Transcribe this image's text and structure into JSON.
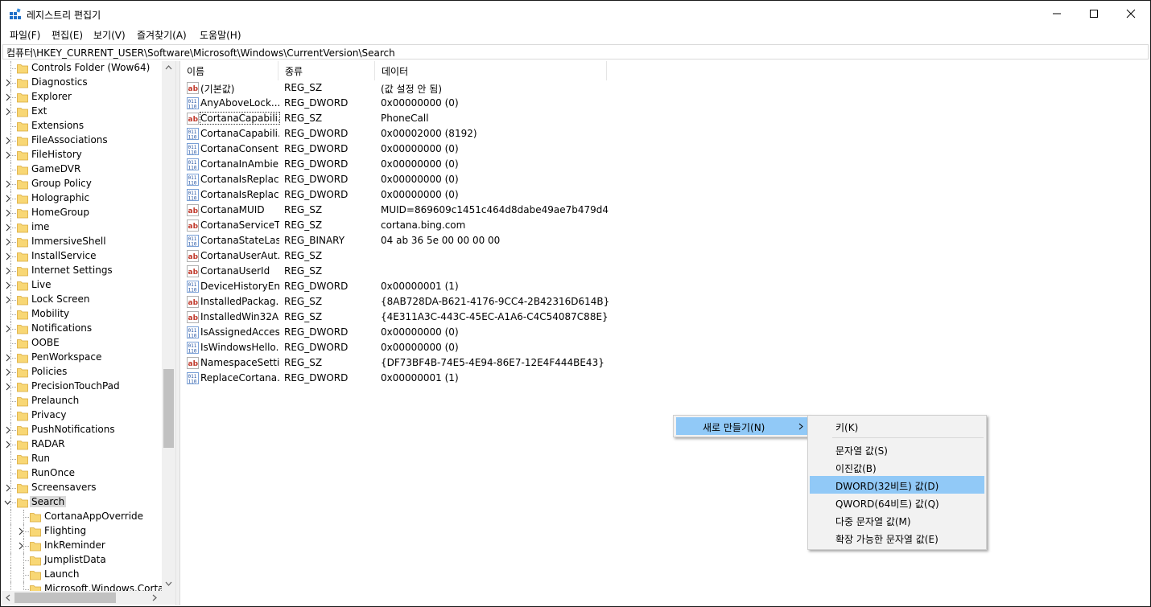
{
  "window": {
    "title": "레지스트리 편집기"
  },
  "menu": [
    "파일(F)",
    "편집(E)",
    "보기(V)",
    "즐겨찾기(A)",
    "도움말(H)"
  ],
  "address": "컴퓨터\\HKEY_CURRENT_USER\\Software\\Microsoft\\Windows\\CurrentVersion\\Search",
  "tree": {
    "items": [
      {
        "label": "Controls Folder (Wow64)",
        "expandable": false
      },
      {
        "label": "Diagnostics",
        "expandable": true
      },
      {
        "label": "Explorer",
        "expandable": true
      },
      {
        "label": "Ext",
        "expandable": true
      },
      {
        "label": "Extensions",
        "expandable": false
      },
      {
        "label": "FileAssociations",
        "expandable": true
      },
      {
        "label": "FileHistory",
        "expandable": true
      },
      {
        "label": "GameDVR",
        "expandable": false
      },
      {
        "label": "Group Policy",
        "expandable": true
      },
      {
        "label": "Holographic",
        "expandable": true
      },
      {
        "label": "HomeGroup",
        "expandable": true
      },
      {
        "label": "ime",
        "expandable": true
      },
      {
        "label": "ImmersiveShell",
        "expandable": true
      },
      {
        "label": "InstallService",
        "expandable": true
      },
      {
        "label": "Internet Settings",
        "expandable": true
      },
      {
        "label": "Live",
        "expandable": true
      },
      {
        "label": "Lock Screen",
        "expandable": true
      },
      {
        "label": "Mobility",
        "expandable": false
      },
      {
        "label": "Notifications",
        "expandable": true
      },
      {
        "label": "OOBE",
        "expandable": false
      },
      {
        "label": "PenWorkspace",
        "expandable": true
      },
      {
        "label": "Policies",
        "expandable": true
      },
      {
        "label": "PrecisionTouchPad",
        "expandable": true
      },
      {
        "label": "Prelaunch",
        "expandable": false
      },
      {
        "label": "Privacy",
        "expandable": false
      },
      {
        "label": "PushNotifications",
        "expandable": true
      },
      {
        "label": "RADAR",
        "expandable": true
      },
      {
        "label": "Run",
        "expandable": false
      },
      {
        "label": "RunOnce",
        "expandable": false
      },
      {
        "label": "Screensavers",
        "expandable": true
      },
      {
        "label": "Search",
        "expandable": true,
        "expanded": true,
        "selected": true
      },
      {
        "label": "CortanaAppOverride",
        "expandable": false,
        "child": true
      },
      {
        "label": "Flighting",
        "expandable": true,
        "child": true
      },
      {
        "label": "InkReminder",
        "expandable": true,
        "child": true
      },
      {
        "label": "JumplistData",
        "expandable": false,
        "child": true
      },
      {
        "label": "Launch",
        "expandable": false,
        "child": true
      },
      {
        "label": "Microsoft.Windows.Cortana",
        "expandable": false,
        "child": true
      }
    ]
  },
  "list": {
    "columns": [
      "이름",
      "종류",
      "데이터"
    ],
    "rows": [
      {
        "icon": "ab",
        "name": "(기본값)",
        "type": "REG_SZ",
        "data": "(값 설정 안 됨)"
      },
      {
        "icon": "bin",
        "name": "AnyAboveLock...",
        "type": "REG_DWORD",
        "data": "0x00000000 (0)"
      },
      {
        "icon": "ab",
        "name": "CortanaCapabili...",
        "type": "REG_SZ",
        "data": "PhoneCall",
        "focused": true
      },
      {
        "icon": "bin",
        "name": "CortanaCapabili...",
        "type": "REG_DWORD",
        "data": "0x00002000 (8192)"
      },
      {
        "icon": "bin",
        "name": "CortanaConsent",
        "type": "REG_DWORD",
        "data": "0x00000000 (0)"
      },
      {
        "icon": "bin",
        "name": "CortanaInAmbie...",
        "type": "REG_DWORD",
        "data": "0x00000000 (0)"
      },
      {
        "icon": "bin",
        "name": "CortanaIsReplac...",
        "type": "REG_DWORD",
        "data": "0x00000000 (0)"
      },
      {
        "icon": "bin",
        "name": "CortanaIsReplac...",
        "type": "REG_DWORD",
        "data": "0x00000000 (0)"
      },
      {
        "icon": "ab",
        "name": "CortanaMUID",
        "type": "REG_SZ",
        "data": "MUID=869609c1451c464d8dabe49ae7b479d4"
      },
      {
        "icon": "ab",
        "name": "CortanaServiceT...",
        "type": "REG_SZ",
        "data": "cortana.bing.com"
      },
      {
        "icon": "bin",
        "name": "CortanaStateLas...",
        "type": "REG_BINARY",
        "data": "04 ab 36 5e 00 00 00 00"
      },
      {
        "icon": "ab",
        "name": "CortanaUserAut...",
        "type": "REG_SZ",
        "data": ""
      },
      {
        "icon": "ab",
        "name": "CortanaUserId",
        "type": "REG_SZ",
        "data": ""
      },
      {
        "icon": "bin",
        "name": "DeviceHistoryEn...",
        "type": "REG_DWORD",
        "data": "0x00000001 (1)"
      },
      {
        "icon": "ab",
        "name": "InstalledPackag...",
        "type": "REG_SZ",
        "data": "{8AB728DA-B621-4176-9CC4-2B42316D614B}"
      },
      {
        "icon": "ab",
        "name": "InstalledWin32A...",
        "type": "REG_SZ",
        "data": "{4E311A3C-443C-45EC-A1A6-C4C54087C88E}"
      },
      {
        "icon": "bin",
        "name": "IsAssignedAccess",
        "type": "REG_DWORD",
        "data": "0x00000000 (0)"
      },
      {
        "icon": "bin",
        "name": "IsWindowsHello...",
        "type": "REG_DWORD",
        "data": "0x00000000 (0)"
      },
      {
        "icon": "ab",
        "name": "NamespaceSetti...",
        "type": "REG_SZ",
        "data": "{DF73BF4B-74E5-4E94-86E7-12E4F444BE43}"
      },
      {
        "icon": "bin",
        "name": "ReplaceCortana...",
        "type": "REG_DWORD",
        "data": "0x00000001 (1)"
      }
    ]
  },
  "context_menu": {
    "new_label": "새로 만들기(N)",
    "submenu": {
      "key": "키(K)",
      "string": "문자열 값(S)",
      "binary": "이진값(B)",
      "dword": "DWORD(32비트) 값(D)",
      "qword": "QWORD(64비트) 값(Q)",
      "multi_string": "다중 문자열 값(M)",
      "expandable_string": "확장 가능한 문자열 값(E)"
    }
  }
}
